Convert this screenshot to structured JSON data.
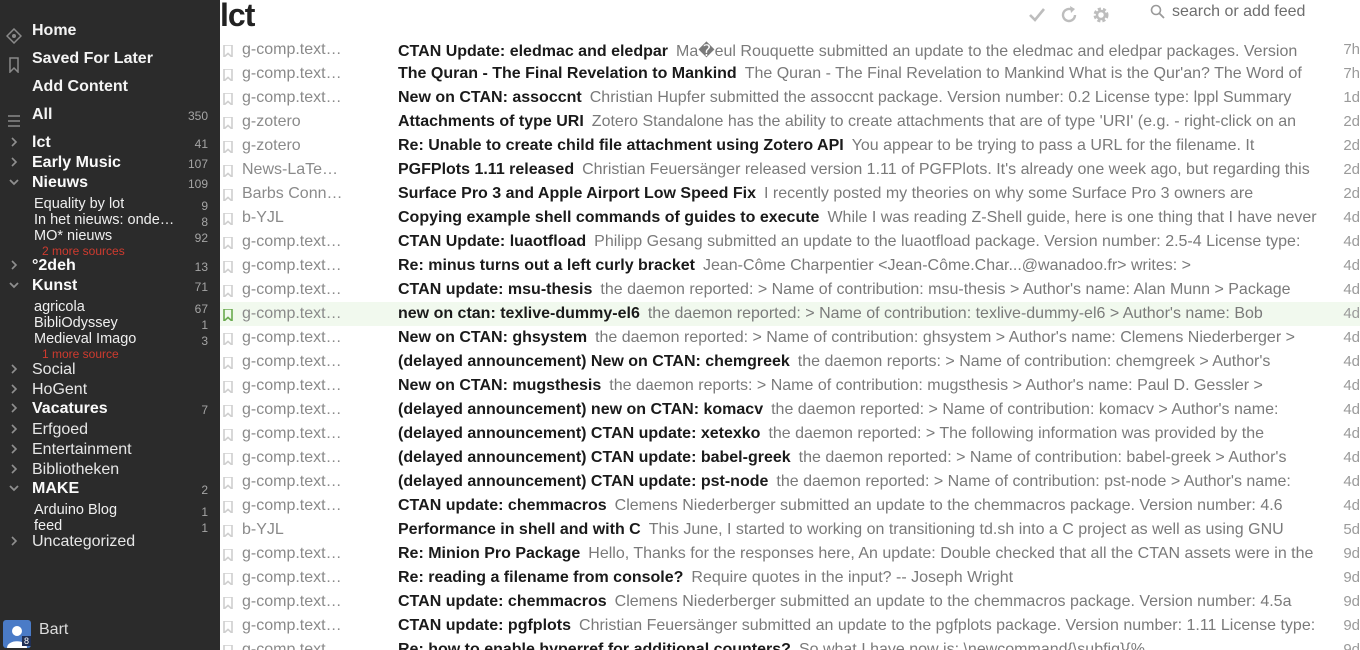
{
  "sidebar": {
    "unpin": "Unpin",
    "nav": {
      "home": "Home",
      "saved": "Saved For Later",
      "add": "Add Content",
      "all": "All",
      "all_count": "350"
    },
    "items": [
      {
        "type": "folder",
        "label": "lct",
        "count": "41",
        "chev": "right",
        "bold": true
      },
      {
        "type": "folder",
        "label": "Early Music",
        "count": "107",
        "chev": "right",
        "bold": true
      },
      {
        "type": "folder",
        "label": "Nieuws",
        "count": "109",
        "chev": "down",
        "bold": true
      },
      {
        "type": "source",
        "label": "Equality by lot",
        "count": "9"
      },
      {
        "type": "source",
        "label": "In het nieuws: onde…",
        "count": "8"
      },
      {
        "type": "source",
        "label": "MO* nieuws",
        "count": "92"
      },
      {
        "type": "more",
        "label": "2 more sources"
      },
      {
        "type": "folder",
        "label": "°2deh",
        "count": "13",
        "chev": "right",
        "bold": true
      },
      {
        "type": "folder",
        "label": "Kunst",
        "count": "71",
        "chev": "down",
        "bold": true
      },
      {
        "type": "source",
        "label": "agricola",
        "count": "67"
      },
      {
        "type": "source",
        "label": "BibliOdyssey",
        "count": "1"
      },
      {
        "type": "source",
        "label": "Medieval Imago",
        "count": "3"
      },
      {
        "type": "more",
        "label": "1 more source"
      },
      {
        "type": "folder",
        "label": "Social",
        "count": "",
        "chev": "right",
        "bold": false
      },
      {
        "type": "folder",
        "label": "HoGent",
        "count": "",
        "chev": "right",
        "bold": false
      },
      {
        "type": "folder",
        "label": "Vacatures",
        "count": "7",
        "chev": "right",
        "bold": true
      },
      {
        "type": "folder",
        "label": "Erfgoed",
        "count": "",
        "chev": "right",
        "bold": false
      },
      {
        "type": "folder",
        "label": "Entertainment",
        "count": "",
        "chev": "right",
        "bold": false
      },
      {
        "type": "folder",
        "label": "Bibliotheken",
        "count": "",
        "chev": "right",
        "bold": false
      },
      {
        "type": "folder",
        "label": "MAKE",
        "count": "2",
        "chev": "down",
        "bold": true
      },
      {
        "type": "source",
        "label": "Arduino Blog",
        "count": "1"
      },
      {
        "type": "source",
        "label": "feed",
        "count": "1"
      },
      {
        "type": "folder",
        "label": "Uncategorized",
        "count": "",
        "chev": "right",
        "bold": false
      }
    ],
    "user": {
      "name": "Bart",
      "badge": "8"
    }
  },
  "main": {
    "title": "lct",
    "search_placeholder": "search or add feed",
    "icons": [
      "checkmark-icon",
      "refresh-icon",
      "gear-icon",
      "search-icon",
      "bookmark-icon"
    ],
    "highlight_color": "#6aaa4f",
    "entries": [
      {
        "src": "g-comp.text…",
        "title": "CTAN Update: eledmac and eledpar",
        "summary": "Ma�eul Rouquette submitted an update to the eledmac and eledpar packages. Version",
        "age": "7h"
      },
      {
        "src": "g-comp.text…",
        "title": "The Quran - The Final Revelation to Mankind",
        "summary": "The Quran - The Final Revelation to Mankind What is the Qur'an? The Word of",
        "age": "7h"
      },
      {
        "src": "g-comp.text…",
        "title": "New on CTAN: assoccnt",
        "summary": "Christian Hupfer submitted the assoccnt package. Version number: 0.2 License type: lppl Summary",
        "age": "1d"
      },
      {
        "src": "g-zotero",
        "title": "Attachments of type URI",
        "summary": "Zotero Standalone has the ability to create attachments that are of type 'URI' (e.g. - right-click on an",
        "age": "2d"
      },
      {
        "src": "g-zotero",
        "title": "Re: Unable to create child file attachment using Zotero API",
        "summary": "You appear to be trying to pass a URL for the filename. It",
        "age": "2d"
      },
      {
        "src": "News-LaTe…",
        "title": "PGFPlots 1.11 released",
        "summary": "Christian Feuersänger released version 1.11 of PGFPlots. It's already one week ago, but regarding this",
        "age": "2d"
      },
      {
        "src": "Barbs Conn…",
        "title": "Surface Pro 3 and Apple Airport Low Speed Fix",
        "summary": "I recently posted my theories on why some Surface Pro 3 owners are",
        "age": "2d"
      },
      {
        "src": "b-YJL",
        "title": "Copying example shell commands of guides to execute",
        "summary": "While I was reading Z-Shell guide, here is one thing that I have never",
        "age": "4d"
      },
      {
        "src": "g-comp.text…",
        "title": "CTAN Update: luaotfload",
        "summary": "Philipp Gesang submitted an update to the luaotfload package. Version number: 2.5-4 License type:",
        "age": "4d"
      },
      {
        "src": "g-comp.text…",
        "title": "Re: minus turns out a left curly bracket",
        "summary": "Jean-Côme Charpentier <Jean-Côme.Char...@wanadoo.fr> writes: >",
        "age": "4d"
      },
      {
        "src": "g-comp.text…",
        "title": "CTAN update: msu-thesis",
        "summary": "the daemon reported: > Name of contribution: msu-thesis > Author's name: Alan Munn > Package",
        "age": "4d"
      },
      {
        "src": "g-comp.text…",
        "title": "new on ctan: texlive-dummy-el6",
        "summary": "the daemon reported: > Name of contribution: texlive-dummy-el6 > Author's name: Bob",
        "age": "4d",
        "hl": true
      },
      {
        "src": "g-comp.text…",
        "title": "New on CTAN: ghsystem",
        "summary": "the daemon reported: > Name of contribution: ghsystem > Author's name: Clemens Niederberger >",
        "age": "4d"
      },
      {
        "src": "g-comp.text…",
        "title": "(delayed announcement) New on CTAN: chemgreek",
        "summary": "the daemon reports: > Name of contribution: chemgreek > Author's",
        "age": "4d"
      },
      {
        "src": "g-comp.text…",
        "title": "New on CTAN: mugsthesis",
        "summary": "the daemon reports: > Name of contribution: mugsthesis > Author's name: Paul D. Gessler >",
        "age": "4d"
      },
      {
        "src": "g-comp.text…",
        "title": "(delayed announcement) new on CTAN: komacv",
        "summary": "the daemon reported: > Name of contribution: komacv > Author's name:",
        "age": "4d"
      },
      {
        "src": "g-comp.text…",
        "title": "(delayed announcement) CTAN update: xetexko",
        "summary": "the daemon reported: > The following information was provided by the",
        "age": "4d"
      },
      {
        "src": "g-comp.text…",
        "title": "(delayed announcement) CTAN update: babel-greek",
        "summary": "the daemon reported: > Name of contribution: babel-greek > Author's",
        "age": "4d"
      },
      {
        "src": "g-comp.text…",
        "title": "(delayed announcement) CTAN update: pst-node",
        "summary": "the daemon reported: > Name of contribution: pst-node > Author's name:",
        "age": "4d"
      },
      {
        "src": "g-comp.text…",
        "title": "CTAN update: chemmacros",
        "summary": "Clemens Niederberger submitted an update to the chemmacros package. Version number: 4.6",
        "age": "4d"
      },
      {
        "src": "b-YJL",
        "title": "Performance in shell and with C",
        "summary": "This June, I started to working on transitioning td.sh into a C project as well as using GNU",
        "age": "5d"
      },
      {
        "src": "g-comp.text…",
        "title": "Re: Minion Pro Package",
        "summary": "Hello, Thanks for the responses here, An update: Double checked that all the CTAN assets were in the",
        "age": "9d"
      },
      {
        "src": "g-comp.text…",
        "title": "Re: reading a filename from console?",
        "summary": "Require quotes in the input? -- Joseph Wright",
        "age": "9d"
      },
      {
        "src": "g-comp.text…",
        "title": "CTAN update: chemmacros",
        "summary": "Clemens Niederberger submitted an update to the chemmacros package. Version number: 4.5a",
        "age": "9d"
      },
      {
        "src": "g-comp.text…",
        "title": "CTAN update: pgfplots",
        "summary": "Christian Feuersänger submitted an update to the pgfplots package. Version number: 1.11 License type:",
        "age": "9d"
      },
      {
        "src": "g-comp.text…",
        "title": "Re: how to enable hyperref for additional counters?",
        "summary": "So what I have now is: \\newcommand{\\subfig}{%",
        "age": "9d"
      }
    ]
  }
}
